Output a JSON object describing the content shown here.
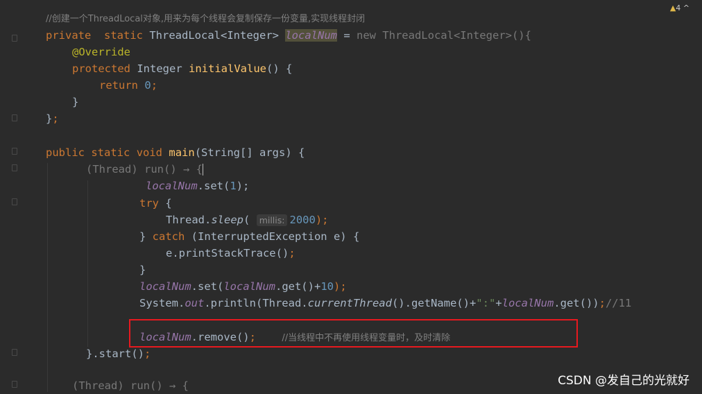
{
  "status": {
    "warning_count": "4",
    "nav_symbol": "^"
  },
  "code": {
    "l1_comment": "//创建一个ThreadLocal对象,用来为每个线程会复制保存一份变量,实现线程封闭",
    "l2_private": "private",
    "l2_static": "static",
    "l2_type": "ThreadLocal<Integer>",
    "l2_field": "localNum",
    "l2_eq": " = ",
    "l2_new": "new ThreadLocal<Integer>(){",
    "l3_annotation": "@Override",
    "l4_protected": "protected",
    "l4_type": " Integer ",
    "l4_method": "initialValue",
    "l4_rest": "() {",
    "l5_return": "return",
    "l5_value": "0",
    "l5_semi": ";",
    "l6_brace": "}",
    "l7_brace": "}",
    "l7_semi": ";",
    "l9_public": "public",
    "l9_static": "static",
    "l9_void": "void",
    "l9_method": "main",
    "l9_rest": "(String[] args) {",
    "l10_lambda": "(Thread) run() → {",
    "l11_field": "localNum",
    "l11_rest": ".set(",
    "l11_value": "1",
    "l11_end": ");",
    "l12_try": "try",
    "l12_rest": " {",
    "l13_prefix": "Thread.",
    "l13_method": "sleep",
    "l13_paren": "(",
    "l13_hint": "millis:",
    "l13_value": "2000",
    "l13_end": ");",
    "l14_brace": "} ",
    "l14_catch": "catch",
    "l14_rest": " (InterruptedException e) {",
    "l15_call": "e.printStackTrace()",
    "l15_semi": ";",
    "l16_brace": "}",
    "l17_field1": "localNum",
    "l17_mid": ".set(",
    "l17_field2": "localNum",
    "l17_rest": ".get()+",
    "l17_value": "10",
    "l17_end": ");",
    "l18_system": "System.",
    "l18_out": "out",
    "l18_print": ".println(Thread.",
    "l18_current": "currentThread",
    "l18_getname": "().getName()+",
    "l18_string": "\":\"",
    "l18_plus": "+",
    "l18_field": "localNum",
    "l18_get": ".get())",
    "l18_semi": ";",
    "l18_comment": "//11",
    "l20_field": "localNum",
    "l20_call": ".remove()",
    "l20_semi": ";",
    "l20_comment": "//当线程中不再使用线程变量时，及时清除",
    "l21_end": "}.start()",
    "l21_semi": ";",
    "l23_lambda": "(Thread) run() → {"
  },
  "watermark": "CSDN @发自己的光就好"
}
